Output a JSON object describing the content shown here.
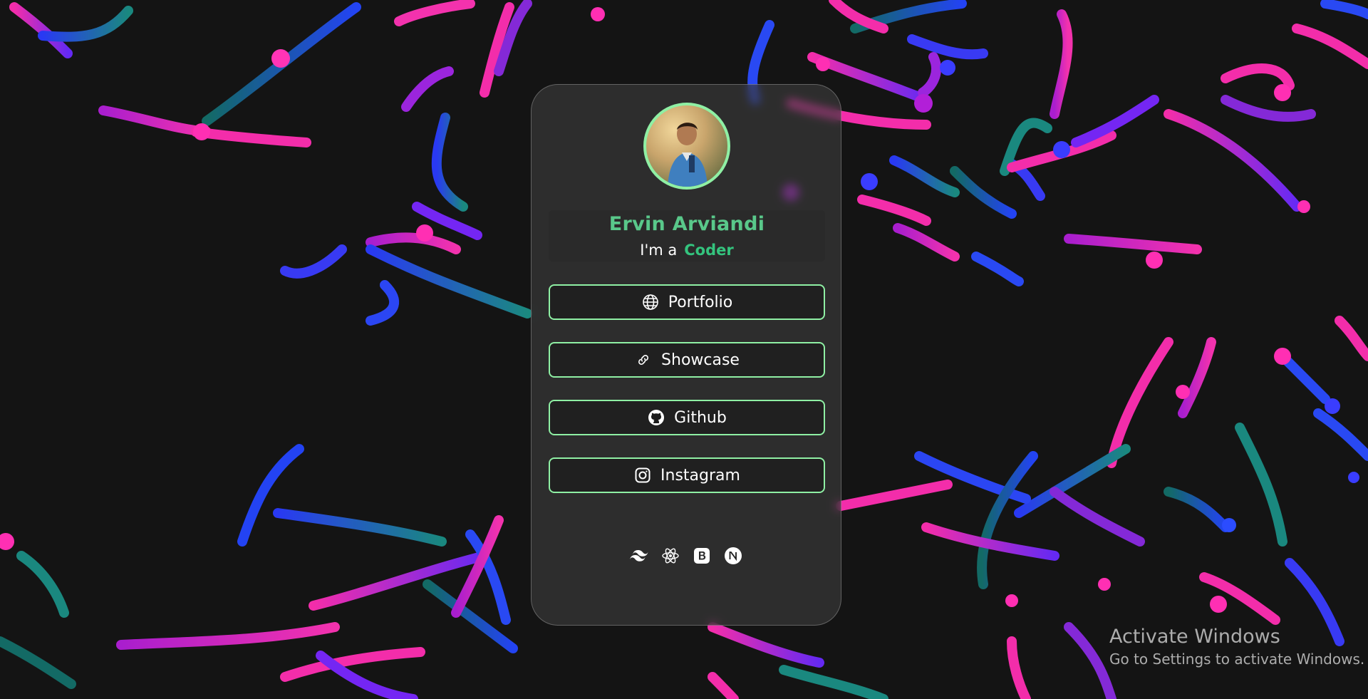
{
  "profile": {
    "name": "Ervin Arviandi",
    "tagline_prefix": "I'm a",
    "role": "Coder"
  },
  "links": [
    {
      "label": "Portfolio",
      "icon": "globe-icon"
    },
    {
      "label": "Showcase",
      "icon": "link-icon"
    },
    {
      "label": "Github",
      "icon": "github-icon"
    },
    {
      "label": "Instagram",
      "icon": "instagram-icon"
    }
  ],
  "tech_stack": [
    "tailwind-icon",
    "react-icon",
    "bootstrap-icon",
    "nextjs-icon"
  ],
  "windows_watermark": {
    "title": "Activate Windows",
    "subtitle": "Go to Settings to activate Windows."
  },
  "colors": {
    "background": "#141414",
    "accent_border": "#8ff0a4",
    "name": "#59c88a",
    "role": "#34c47e",
    "stroke_pink": "#ff2fb3",
    "stroke_purple": "#8a2be2",
    "stroke_blue": "#1e3cff",
    "stroke_teal": "#1b8f85"
  }
}
